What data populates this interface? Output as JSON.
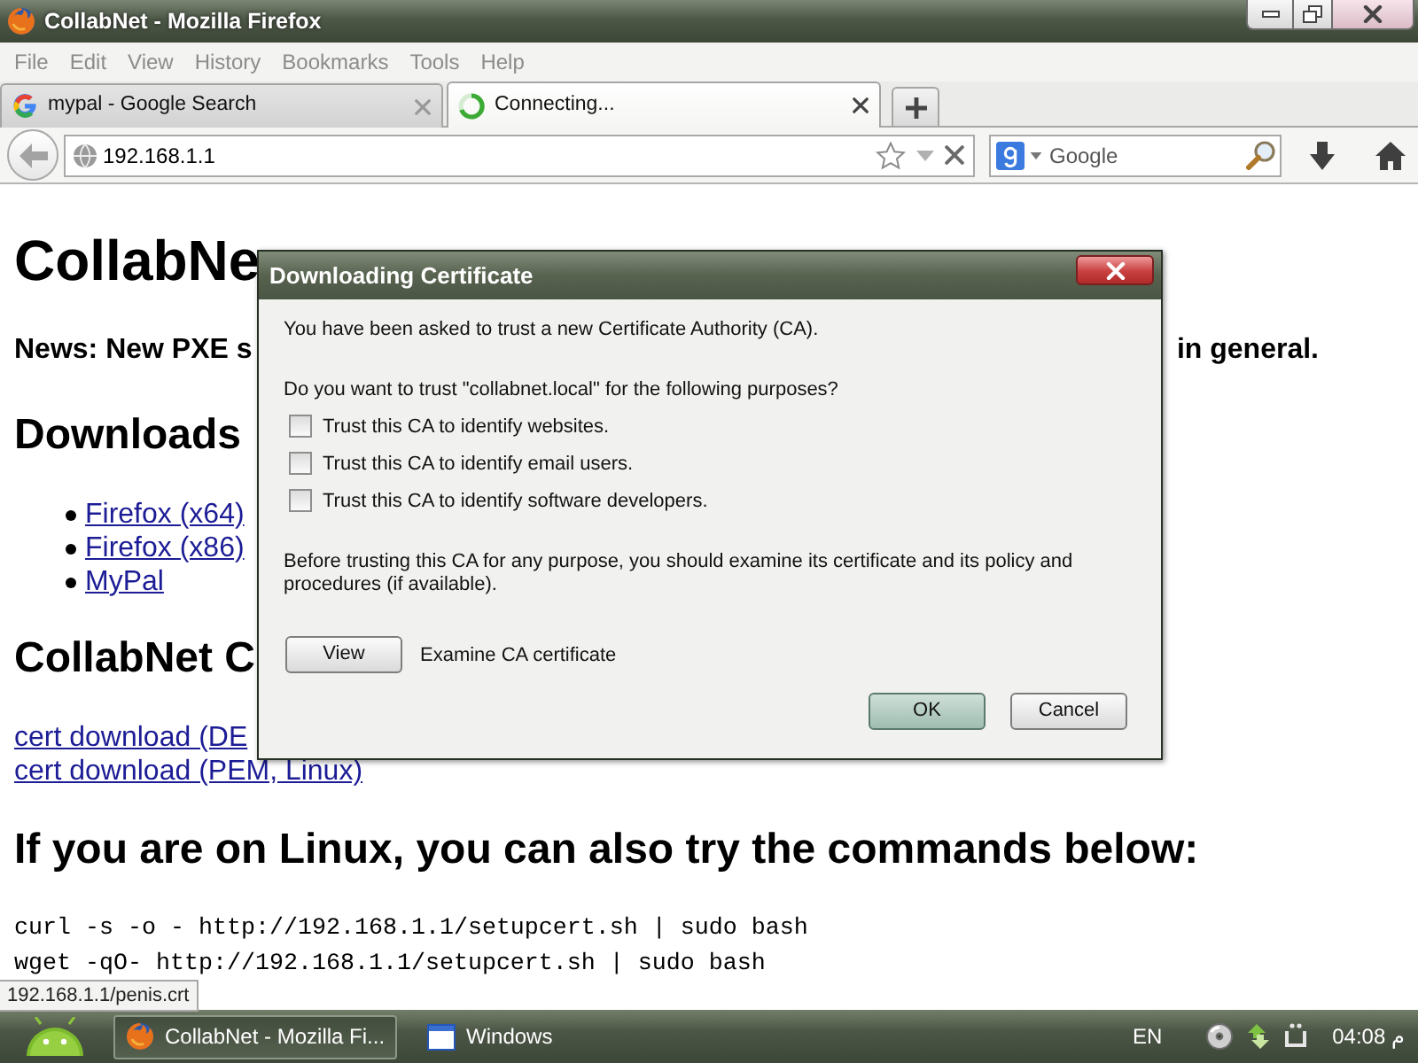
{
  "window": {
    "title": "CollabNet - Mozilla Firefox"
  },
  "menu": [
    "File",
    "Edit",
    "View",
    "History",
    "Bookmarks",
    "Tools",
    "Help"
  ],
  "tabs": [
    {
      "title": "mypal - Google Search",
      "loading": false,
      "selected": false
    },
    {
      "title": "Connecting...",
      "loading": true,
      "selected": true
    }
  ],
  "address_bar": {
    "value": "192.168.1.1"
  },
  "search_bar": {
    "placeholder": "Google"
  },
  "page": {
    "heading": "CollabNe",
    "news": {
      "left": "News: New PXE s",
      "right": "in general."
    },
    "downloads_heading": "Downloads",
    "download_links": [
      "Firefox (x64)",
      "Firefox (x86)",
      "MyPal"
    ],
    "cert_heading": "CollabNet C",
    "cert_links": [
      "cert download (DE",
      "cert download (PEM, Linux)"
    ],
    "linux_heading": "If you are on Linux, you can also try the commands below:",
    "commands": [
      "curl -s -o - http://192.168.1.1/setupcert.sh | sudo bash",
      "wget -qO- http://192.168.1.1/setupcert.sh | sudo bash"
    ]
  },
  "status_link": "192.168.1.1/penis.crt",
  "dialog": {
    "title": "Downloading Certificate",
    "intro": "You have been asked to trust a new Certificate Authority (CA).",
    "question": "Do you want to trust \"collabnet.local\" for the following purposes?",
    "purposes": [
      {
        "label": "Trust this CA to identify websites.",
        "checked": false
      },
      {
        "label": "Trust this CA to identify email users.",
        "checked": false
      },
      {
        "label": "Trust this CA to identify software developers.",
        "checked": false
      }
    ],
    "advice": "Before trusting this CA for any purpose, you should examine its certificate and its policy and procedures (if available).",
    "view_button": "View",
    "view_caption": "Examine CA certificate",
    "buttons": [
      {
        "label": "OK",
        "default": true
      },
      {
        "label": "Cancel",
        "default": false
      }
    ]
  },
  "taskbar": {
    "tasks": [
      {
        "label": "CollabNet - Mozilla Fi...",
        "kind": "browser",
        "selected": true
      },
      {
        "label": "Windows",
        "kind": "window",
        "selected": false
      }
    ],
    "language": "EN",
    "clock": "04:08 م"
  }
}
